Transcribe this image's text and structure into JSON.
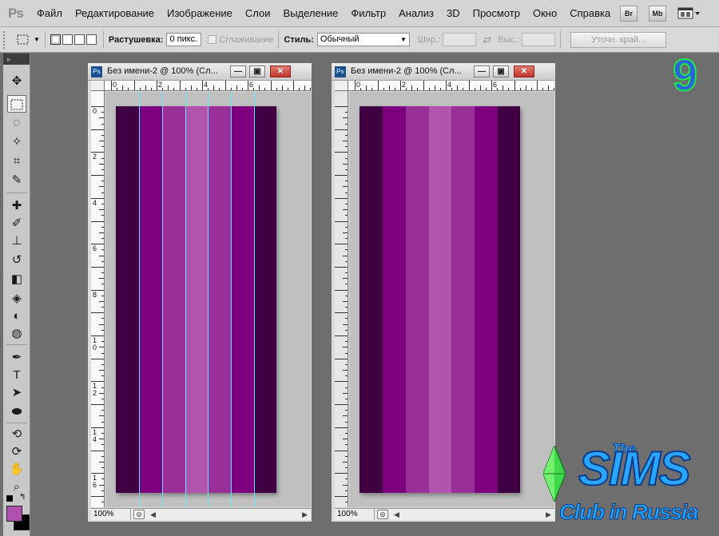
{
  "app": {
    "logo": "Ps",
    "menu": [
      "Файл",
      "Редактирование",
      "Изображение",
      "Слои",
      "Выделение",
      "Фильтр",
      "Анализ",
      "3D",
      "Просмотр",
      "Окно",
      "Справка"
    ],
    "bridge_button": "Br",
    "minibridge_button": "Mb"
  },
  "options": {
    "feather_label": "Растушевка:",
    "feather_value": "0 пикс.",
    "antialias_label": "Сглаживание",
    "style_label": "Стиль:",
    "style_value": "Обычный",
    "width_label": "Шир.:",
    "height_label": "Выс.:",
    "refine_edge_label": "Уточн. край..."
  },
  "windows": [
    {
      "title": "Без имени-2 @ 100% (Сл...",
      "zoom": "100%",
      "ruler_h": [
        "0",
        "2",
        "4",
        "6"
      ],
      "ruler_v": [
        "0",
        "2",
        "4",
        "6",
        "8",
        "1 0",
        "1 2",
        "1 4",
        "1 6"
      ]
    },
    {
      "title": "Без имени-2 @ 100% (Сл...",
      "zoom": "100%",
      "ruler_h": [
        "0",
        "2",
        "4",
        "6"
      ],
      "ruler_v": []
    }
  ],
  "stripes": [
    "#3e0040",
    "#7d007e",
    "#9a2f99",
    "#b054ad",
    "#9a2f99",
    "#7d007e",
    "#3e0040"
  ],
  "guide_color": "#5fe8ff",
  "colors": {
    "foreground": "#b04fb0",
    "background": "#000000"
  },
  "overlay": {
    "step_number": "9",
    "logo_the": "The",
    "logo_main": "SIMS",
    "logo_sub": "Club in Russia"
  }
}
